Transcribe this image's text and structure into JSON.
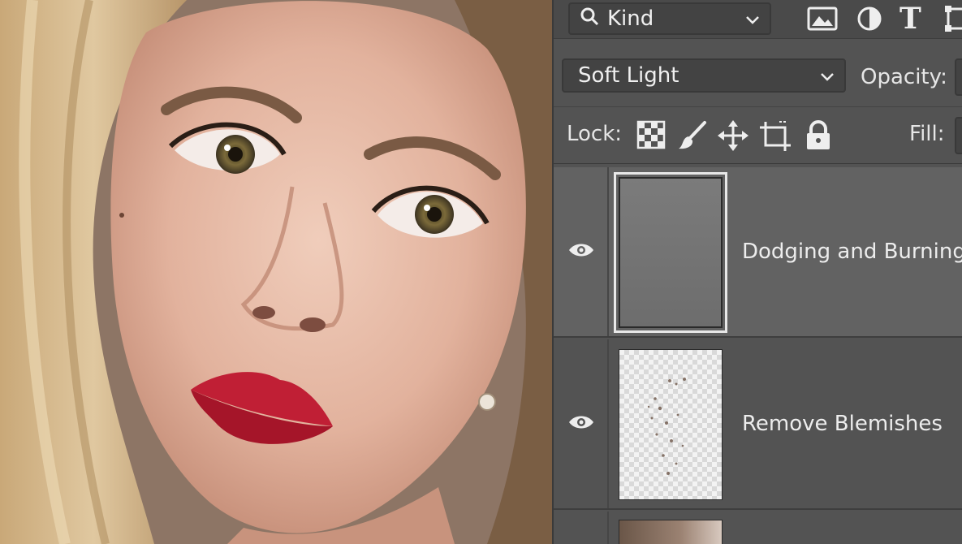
{
  "filter": {
    "kind_label": "Kind",
    "icons": [
      "image-filter-icon",
      "adjustment-filter-icon",
      "type-filter-icon",
      "shape-filter-icon"
    ],
    "type_glyph": "T"
  },
  "blend": {
    "mode": "Soft Light",
    "opacity_label": "Opacity:"
  },
  "lock": {
    "label": "Lock:",
    "icons": [
      "lock-transparent-icon",
      "lock-paint-icon",
      "lock-move-icon",
      "lock-artboard-icon",
      "lock-all-icon"
    ],
    "fill_label": "Fill:"
  },
  "layers": [
    {
      "name": "Dodging and Burning",
      "visible": true,
      "selected": true,
      "thumbnail": "gray-fill"
    },
    {
      "name": "Remove Blemishes",
      "visible": true,
      "selected": false,
      "thumbnail": "transparent"
    },
    {
      "name": "",
      "visible": true,
      "selected": false,
      "thumbnail": "photo"
    }
  ],
  "colors": {
    "panel_bg": "#535353",
    "selected_layer_bg": "#626262",
    "text": "#ededed"
  }
}
